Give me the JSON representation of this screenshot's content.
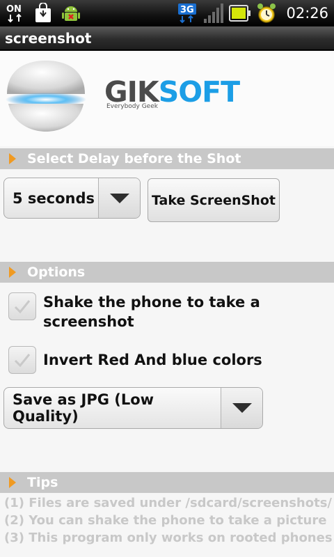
{
  "status_bar": {
    "icons": [
      "usb-debug-icon",
      "market-update-icon",
      "android-notification-icon",
      "3g-icon",
      "signal-icon",
      "battery-icon",
      "alarm-clock-icon"
    ],
    "usb_label": "ON",
    "network_label": "3G",
    "time": "02:26"
  },
  "title_bar": {
    "title": "screenshot"
  },
  "header": {
    "brand_part1": "GIK",
    "brand_part2": "SOFT",
    "tagline": "Everybody Geek"
  },
  "delay_section": {
    "title": "Select Delay before the Shot",
    "delay_value": "5 seconds",
    "take_button": "Take ScreenShot"
  },
  "options_section": {
    "title": "Options",
    "shake_label": "Shake the phone to take a screenshot",
    "shake_checked": true,
    "invert_label": "Invert Red And blue colors",
    "invert_checked": true,
    "format_value": "Save as JPG (Low Quality)"
  },
  "tips_section": {
    "title": "Tips",
    "lines": [
      "(1) Files are saved under /sdcard/screenshots/",
      "(2) You can shake the phone to take a picture",
      "(3) This program only works on rooted phones"
    ]
  },
  "colors": {
    "accent_arrow": "#f09a22",
    "brand_blue": "#1c9ee6",
    "section_bg": "#c8c8c8"
  }
}
